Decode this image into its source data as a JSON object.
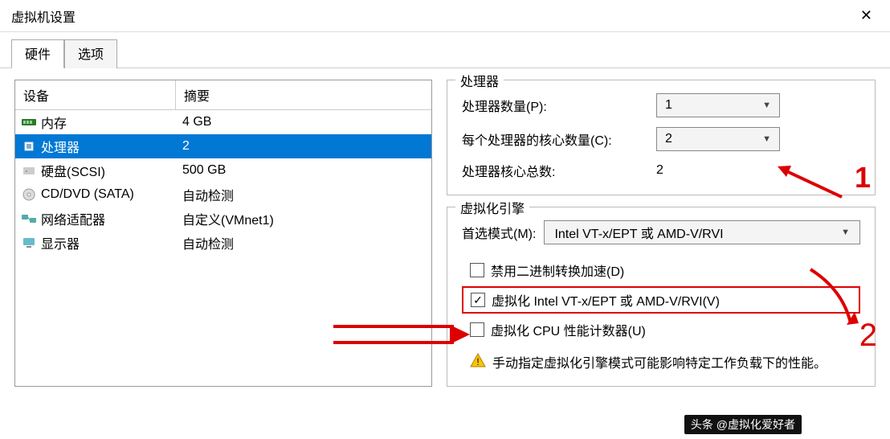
{
  "window": {
    "title": "虚拟机设置"
  },
  "tabs": [
    {
      "label": "硬件",
      "active": true
    },
    {
      "label": "选项",
      "active": false
    }
  ],
  "deviceTable": {
    "headers": {
      "device": "设备",
      "summary": "摘要"
    },
    "rows": [
      {
        "icon": "memory-icon",
        "name": "内存",
        "summary": "4 GB",
        "selected": false
      },
      {
        "icon": "cpu-icon",
        "name": "处理器",
        "summary": "2",
        "selected": true
      },
      {
        "icon": "disk-icon",
        "name": "硬盘(SCSI)",
        "summary": "500 GB",
        "selected": false
      },
      {
        "icon": "cd-icon",
        "name": "CD/DVD (SATA)",
        "summary": "自动检测",
        "selected": false
      },
      {
        "icon": "network-icon",
        "name": "网络适配器",
        "summary": "自定义(VMnet1)",
        "selected": false
      },
      {
        "icon": "display-icon",
        "name": "显示器",
        "summary": "自动检测",
        "selected": false
      }
    ]
  },
  "processorPanel": {
    "title": "处理器",
    "procCountLabel": "处理器数量(P):",
    "procCountValue": "1",
    "coresPerProcLabel": "每个处理器的核心数量(C):",
    "coresPerProcValue": "2",
    "totalCoresLabel": "处理器核心总数:",
    "totalCoresValue": "2"
  },
  "virtEngine": {
    "title": "虚拟化引擎",
    "modeLabel": "首选模式(M):",
    "modeValue": "Intel VT-x/EPT 或 AMD-V/RVI",
    "checkboxes": [
      {
        "label": "禁用二进制转换加速(D)",
        "checked": false,
        "highlighted": false
      },
      {
        "label": "虚拟化 Intel VT-x/EPT 或 AMD-V/RVI(V)",
        "checked": true,
        "highlighted": true
      },
      {
        "label": "虚拟化 CPU 性能计数器(U)",
        "checked": false,
        "highlighted": false
      }
    ],
    "warning": "手动指定虚拟化引擎模式可能影响特定工作负载下的性能。"
  },
  "annotations": {
    "anno1": "1",
    "anno2": "2"
  },
  "watermark": "头条 @虚拟化爱好者"
}
